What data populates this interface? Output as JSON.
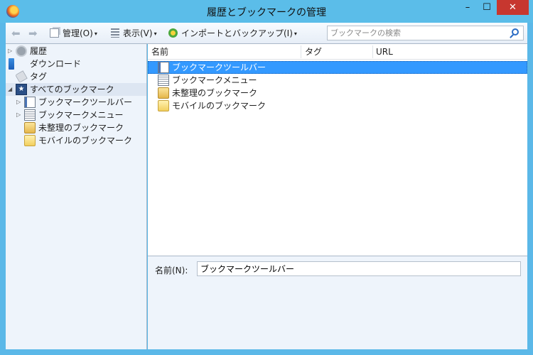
{
  "window": {
    "title": "履歴とブックマークの管理",
    "minimize": "–",
    "maximize": "☐",
    "close": "✕"
  },
  "toolbar": {
    "back": "⬅",
    "forward": "➡",
    "organize_label": "管理(O)",
    "views_label": "表示(V)",
    "import_backup_label": "インポートとバックアップ(I)",
    "dropdown_arrow": "▾",
    "search_placeholder": "ブックマークの検索"
  },
  "sidebar": {
    "items": [
      {
        "label": "履歴",
        "icon": "history-icon",
        "twisty": "▷"
      },
      {
        "label": "ダウンロード",
        "icon": "download-icon",
        "twisty": ""
      },
      {
        "label": "タグ",
        "icon": "tag-icon",
        "twisty": ""
      },
      {
        "label": "すべてのブックマーク",
        "icon": "all-bookmarks-icon",
        "twisty": "◢",
        "selected": true
      },
      {
        "label": "ブックマークツールバー",
        "icon": "bookmarks-toolbar-icon",
        "twisty": "▷"
      },
      {
        "label": "ブックマークメニュー",
        "icon": "bookmarks-menu-icon",
        "twisty": "▷"
      },
      {
        "label": "未整理のブックマーク",
        "icon": "unsorted-bookmarks-icon",
        "twisty": ""
      },
      {
        "label": "モバイルのブックマーク",
        "icon": "mobile-bookmarks-folder-icon",
        "twisty": ""
      }
    ]
  },
  "list": {
    "columns": [
      "名前",
      "タグ",
      "URL"
    ],
    "rows": [
      {
        "name": "ブックマークツールバー",
        "icon": "bookmarks-toolbar-icon",
        "selected": true
      },
      {
        "name": "ブックマークメニュー",
        "icon": "bookmarks-menu-icon"
      },
      {
        "name": "未整理のブックマーク",
        "icon": "unsorted-bookmarks-icon"
      },
      {
        "name": "モバイルのブックマーク",
        "icon": "mobile-bookmarks-folder-icon"
      }
    ]
  },
  "details": {
    "name_label": "名前(N):",
    "name_value": "ブックマークツールバー"
  }
}
